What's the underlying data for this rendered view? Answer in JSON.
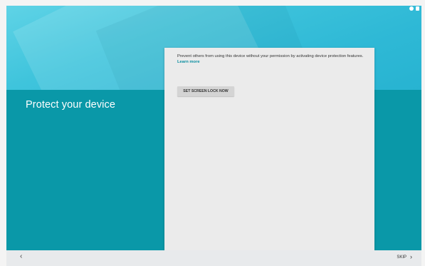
{
  "setup": {
    "title": "Protect your device",
    "description": "Prevent others from using this device without your permission by activating device protection features.",
    "learn_more": "Learn more",
    "set_screen_lock_button": "SET SCREEN LOCK NOW"
  },
  "navigation": {
    "back_icon": "‹",
    "skip_label": "SKIP",
    "skip_icon": "›"
  },
  "colors": {
    "teal_background": "#0a98a8",
    "hero_cyan": "#3fc4dc",
    "card_background": "#ebebeb",
    "link_color": "#0a8ea0"
  }
}
